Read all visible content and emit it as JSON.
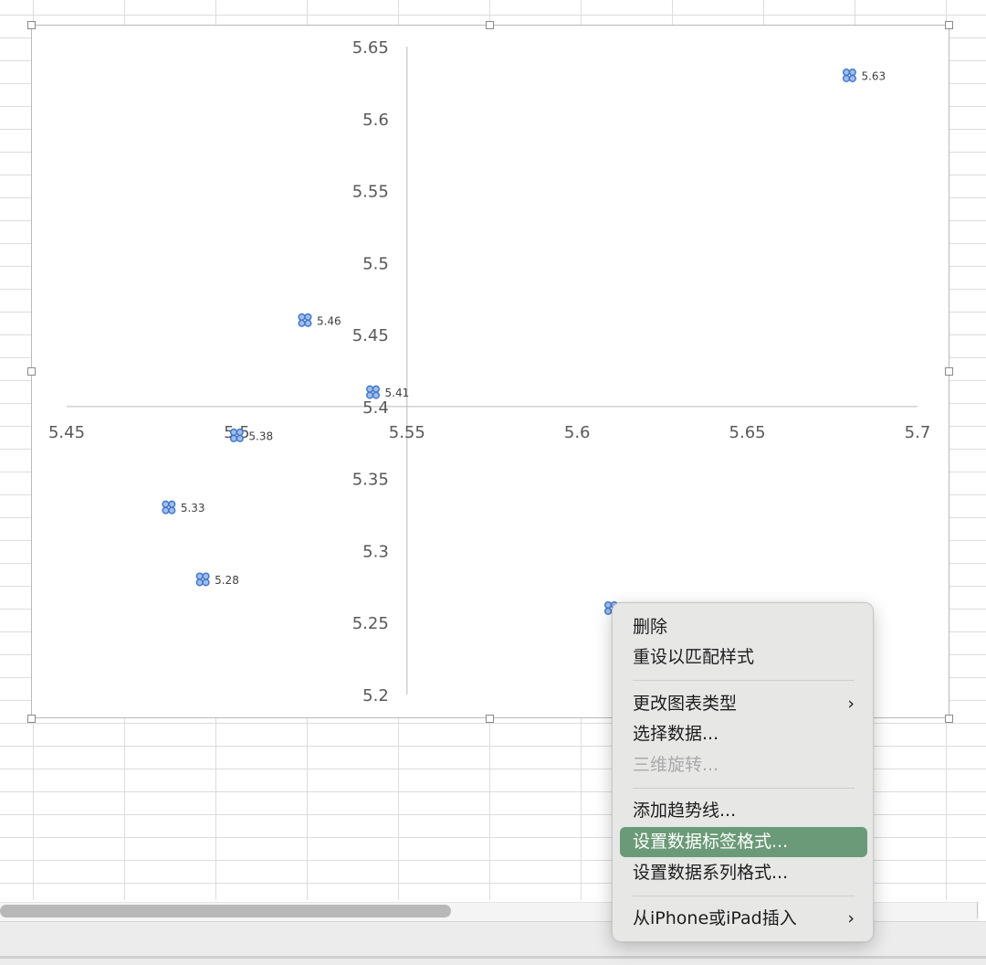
{
  "chart_data": {
    "type": "scatter",
    "title": "",
    "xlabel": "",
    "ylabel": "",
    "xlim": [
      5.45,
      5.7
    ],
    "ylim": [
      5.2,
      5.65
    ],
    "x_ticks": [
      "5.45",
      "5.5",
      "5.55",
      "5.6",
      "5.65",
      "5.7"
    ],
    "y_ticks": [
      "5.2",
      "5.25",
      "5.3",
      "5.35",
      "5.4",
      "5.45",
      "5.5",
      "5.55",
      "5.6",
      "5.65"
    ],
    "axis_cross": {
      "x": 5.55,
      "y": 5.4
    },
    "grid": false,
    "legend": "none",
    "marker_color": "#3d74c9",
    "points": [
      {
        "x": 5.52,
        "y": 5.46,
        "label": "5.46"
      },
      {
        "x": 5.54,
        "y": 5.41,
        "label": "5.41"
      },
      {
        "x": 5.5,
        "y": 5.38,
        "label": "5.38"
      },
      {
        "x": 5.48,
        "y": 5.33,
        "label": "5.33"
      },
      {
        "x": 5.49,
        "y": 5.28,
        "label": "5.28"
      },
      {
        "x": 5.68,
        "y": 5.63,
        "label": "5.63"
      },
      {
        "x": 5.61,
        "y": 5.26,
        "label": ""
      }
    ]
  },
  "context_menu": {
    "items": [
      {
        "label": "删除",
        "enabled": true
      },
      {
        "label": "重设以匹配样式",
        "enabled": true
      },
      {
        "label": "更改图表类型",
        "enabled": true,
        "submenu": true
      },
      {
        "label": "选择数据...",
        "enabled": true
      },
      {
        "label": "三维旋转...",
        "enabled": false
      },
      {
        "label": "添加趋势线...",
        "enabled": true
      },
      {
        "label": "设置数据标签格式...",
        "enabled": true,
        "highlighted": true
      },
      {
        "label": "设置数据系列格式...",
        "enabled": true
      },
      {
        "label": "从iPhone或iPad插入",
        "enabled": true,
        "submenu": true
      }
    ],
    "submenu_glyph": "›"
  }
}
